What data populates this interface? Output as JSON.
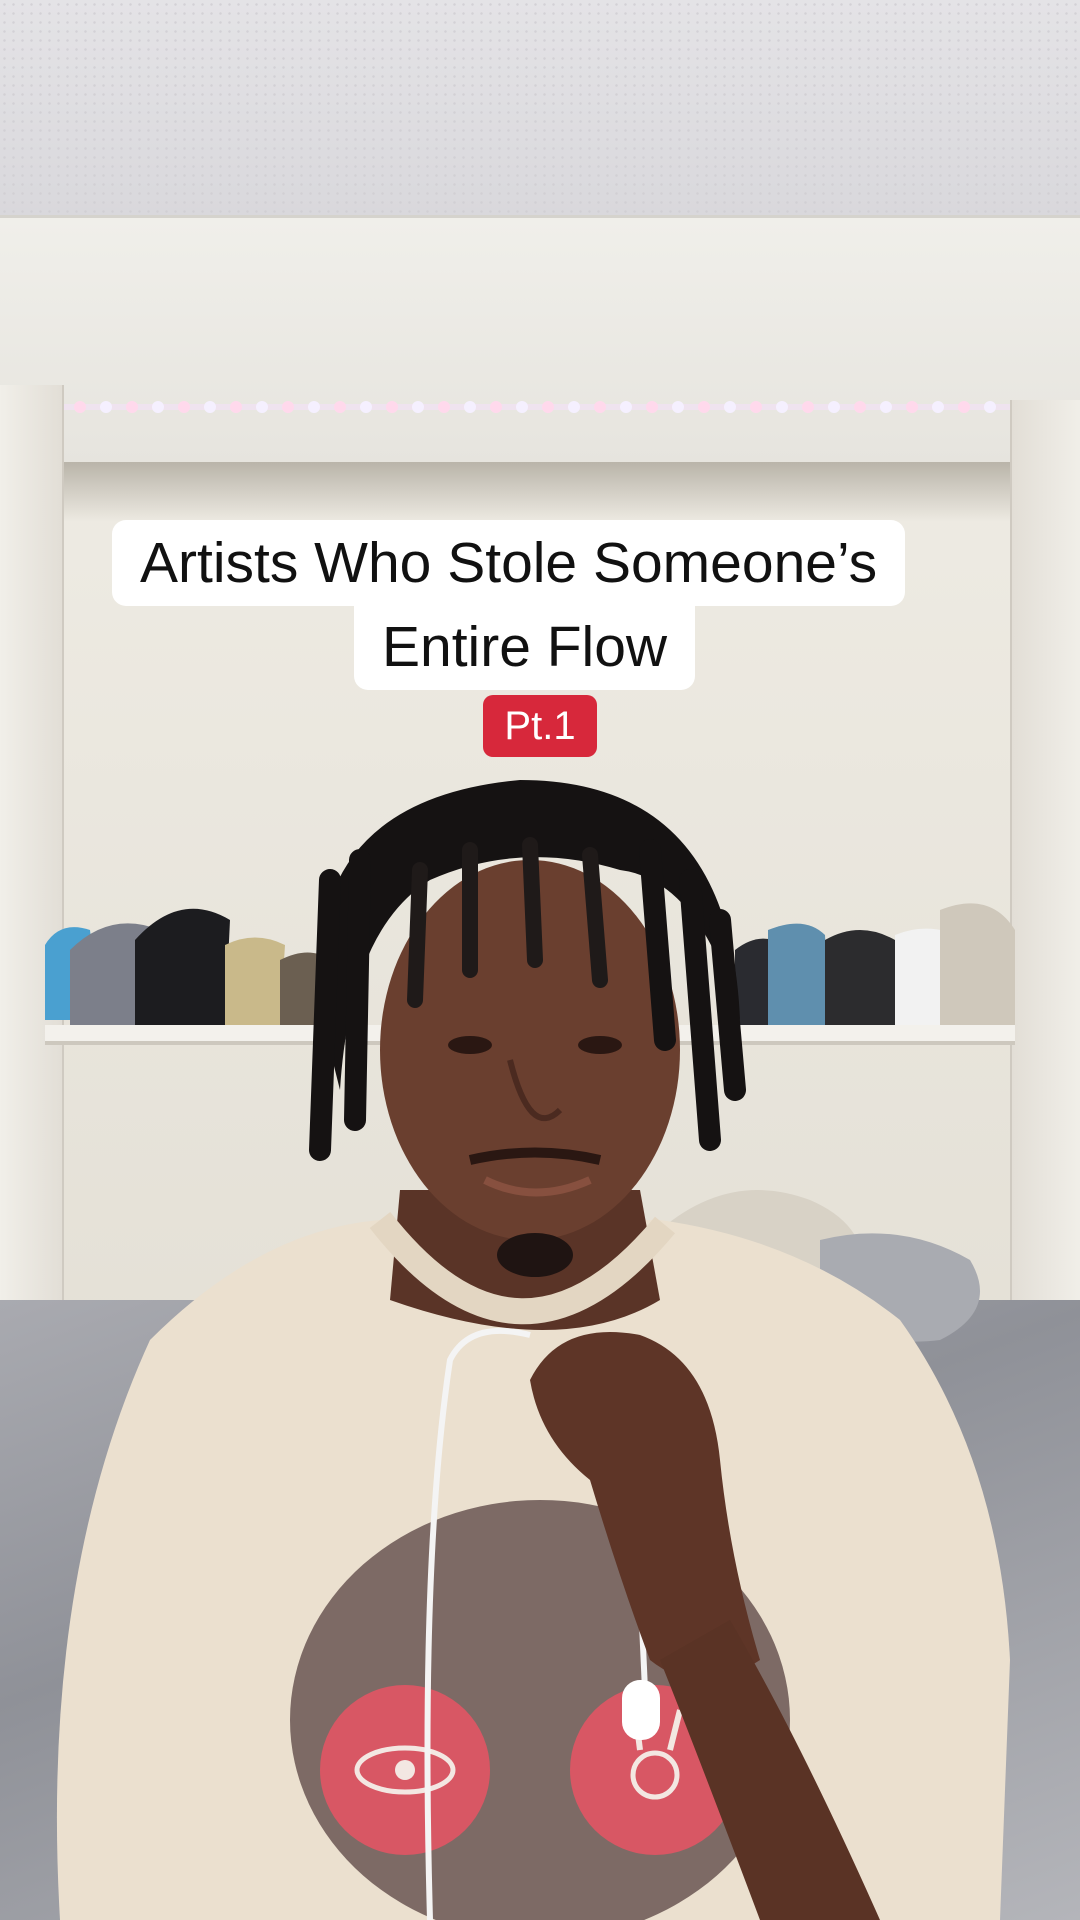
{
  "video": {
    "title_lines": [
      "Artists Who Stole Someone’s",
      "Entire Flow"
    ],
    "part_label": "Pt.1"
  },
  "colors": {
    "caption_background": "#ffffff",
    "caption_text": "#111111",
    "part_badge_background": "#d7283b",
    "part_badge_text": "#ffffff"
  }
}
